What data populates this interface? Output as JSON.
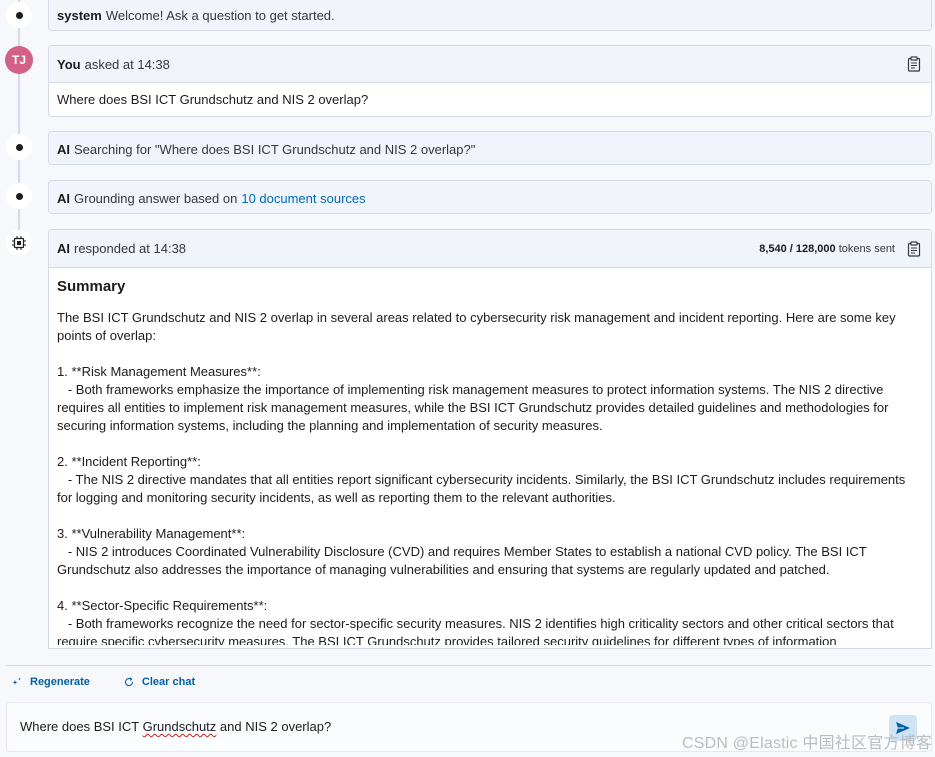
{
  "messages": {
    "system": {
      "who": "system",
      "text": "Welcome! Ask a question to get started."
    },
    "user": {
      "avatar": "TJ",
      "who": "You",
      "text": "asked at 14:38",
      "body": "Where does BSI ICT Grundschutz and NIS 2 overlap?"
    },
    "search": {
      "who": "AI",
      "text": "Searching for \"Where does BSI ICT Grundschutz and NIS 2 overlap?\""
    },
    "grounding": {
      "who": "AI",
      "text": "Grounding answer based on",
      "link": "10 document sources"
    },
    "response": {
      "who": "AI",
      "text": "responded at 14:38",
      "tokens_count": "8,540 / 128,000",
      "tokens_label": "tokens sent",
      "heading": "Summary",
      "paragraphs": [
        "The BSI ICT Grundschutz and NIS 2 overlap in several areas related to cybersecurity risk management and incident reporting. Here are some key points of overlap:",
        "1. **Risk Management Measures**:\n   - Both frameworks emphasize the importance of implementing risk management measures to protect information systems. The NIS 2 directive requires all entities to implement risk management measures, while the BSI ICT Grundschutz provides detailed guidelines and methodologies for securing information systems, including the planning and implementation of security measures.",
        "2. **Incident Reporting**:\n   - The NIS 2 directive mandates that all entities report significant cybersecurity incidents. Similarly, the BSI ICT Grundschutz includes requirements for logging and monitoring security incidents, as well as reporting them to the relevant authorities.",
        "3. **Vulnerability Management**:\n   - NIS 2 introduces Coordinated Vulnerability Disclosure (CVD) and requires Member States to establish a national CVD policy. The BSI ICT Grundschutz also addresses the importance of managing vulnerabilities and ensuring that systems are regularly updated and patched.",
        "4. **Sector-Specific Requirements**:\n   - Both frameworks recognize the need for sector-specific security measures. NIS 2 identifies high criticality sectors and other critical sectors that require specific cybersecurity measures. The BSI ICT Grundschutz provides tailored security guidelines for different types of information"
      ]
    }
  },
  "actions": {
    "regenerate": "Regenerate",
    "clear": "Clear chat"
  },
  "prompt": {
    "before": "Where does BSI ICT ",
    "misspelled": "Grundschutz",
    "after": " and NIS 2 overlap?"
  },
  "watermark": "CSDN @Elastic 中国社区官方博客",
  "colors": {
    "accent": "#006bb8",
    "avatar": "#d36086",
    "send": "#cce4f5"
  }
}
